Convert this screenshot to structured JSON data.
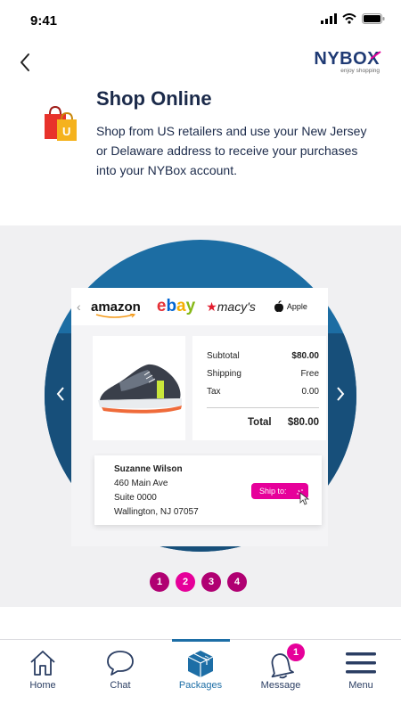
{
  "status_bar": {
    "time": "9:41"
  },
  "header": {
    "brand_name": "NYBOX",
    "brand_tagline": "enjoy shopping"
  },
  "intro": {
    "title": "Shop Online",
    "text": "Shop from US retailers and use your New Jersey or Delaware address to receive your purchases into your NYBox account."
  },
  "carousel": {
    "retailers": [
      "amazon",
      "ebay",
      "macy's",
      "Apple"
    ],
    "summary": {
      "subtotal_label": "Subtotal",
      "subtotal_value": "$80.00",
      "shipping_label": "Shipping",
      "shipping_value": "Free",
      "tax_label": "Tax",
      "tax_value": "0.00",
      "total_label": "Total",
      "total_value": "$80.00"
    },
    "address": {
      "name": "Suzanne Wilson",
      "line1": "460 Main Ave",
      "line2": "Suite 0000",
      "line3": "Wallington, NJ 07057"
    },
    "ship_button": "Ship to:",
    "pages": [
      "1",
      "2",
      "3",
      "4"
    ],
    "active_page": 2
  },
  "tabs": [
    {
      "label": "Home",
      "icon": "home-icon"
    },
    {
      "label": "Chat",
      "icon": "chat-icon"
    },
    {
      "label": "Packages",
      "icon": "package-icon"
    },
    {
      "label": "Message",
      "icon": "bell-icon",
      "badge": "1"
    },
    {
      "label": "Menu",
      "icon": "menu-icon"
    }
  ],
  "colors": {
    "accent_pink": "#e6009a",
    "brand_blue": "#1d6ea6",
    "navy": "#1b2a4a"
  }
}
